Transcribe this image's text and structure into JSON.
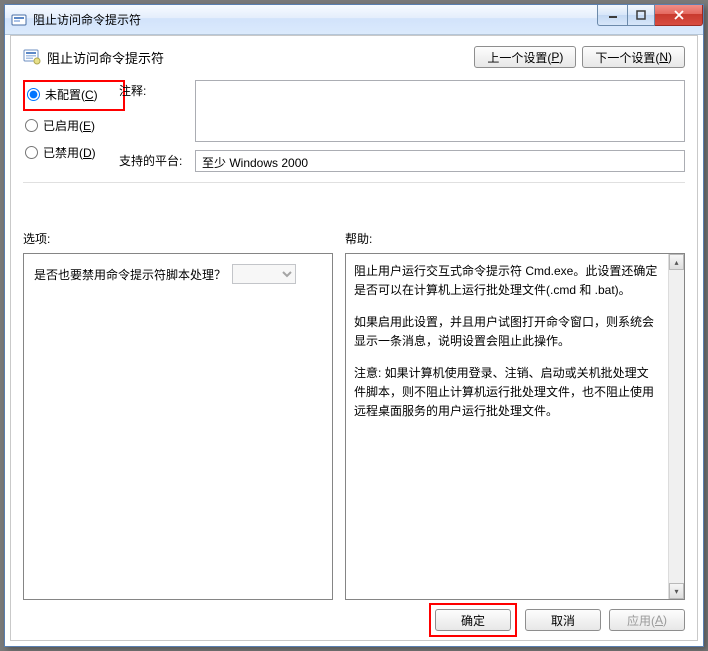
{
  "window": {
    "title": "阻止访问命令提示符"
  },
  "header": {
    "title": "阻止访问命令提示符",
    "prev_btn": "上一个设置(",
    "prev_key": "P",
    "prev_btn_tail": ")",
    "next_btn": "下一个设置(",
    "next_key": "N",
    "next_btn_tail": ")"
  },
  "radios": {
    "not_configured": "未配置(",
    "not_configured_key": "C",
    "not_configured_tail": ")",
    "enabled": "已启用(",
    "enabled_key": "E",
    "enabled_tail": ")",
    "disabled": "已禁用(",
    "disabled_key": "D",
    "disabled_tail": ")"
  },
  "fields": {
    "comment_label": "注释:",
    "platform_label": "支持的平台:",
    "platform_value": "至少 Windows 2000"
  },
  "lower": {
    "options_label": "选项:",
    "help_label": "帮助:",
    "option_question": "是否也要禁用命令提示符脚本处理？"
  },
  "help": {
    "p1": "阻止用户运行交互式命令提示符 Cmd.exe。此设置还确定是否可以在计算机上运行批处理文件(.cmd 和 .bat)。",
    "p2": "如果启用此设置，并且用户试图打开命令窗口，则系统会显示一条消息，说明设置会阻止此操作。",
    "p3": "注意: 如果计算机使用登录、注销、启动或关机批处理文件脚本，则不阻止计算机运行批处理文件，也不阻止使用远程桌面服务的用户运行批处理文件。"
  },
  "footer": {
    "ok": "确定",
    "cancel": "取消",
    "apply": "应用(",
    "apply_key": "A",
    "apply_tail": ")"
  }
}
